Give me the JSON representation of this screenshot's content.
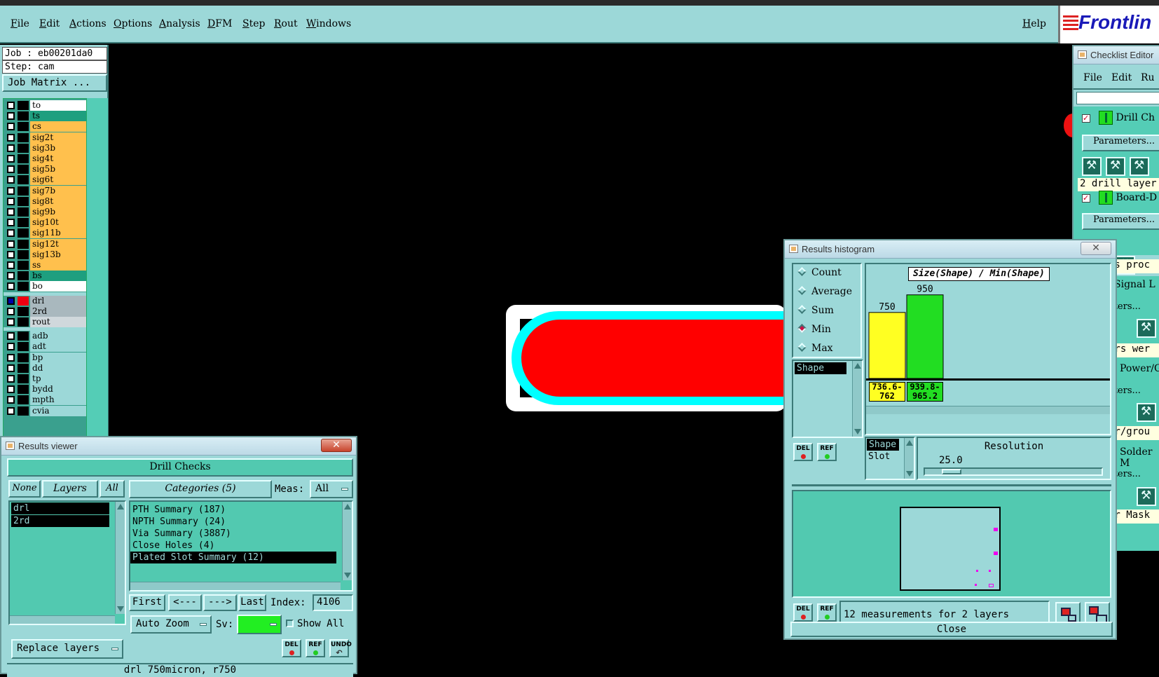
{
  "menubar": {
    "items": [
      "File",
      "Edit",
      "Actions",
      "Options",
      "Analysis",
      "DFM",
      "Step",
      "Rout",
      "Windows"
    ],
    "help": "Help",
    "logo": "Frontlin"
  },
  "leftpanel": {
    "job": "Job : eb00201da0",
    "step": "Step: cam",
    "job_matrix": "Job Matrix ...",
    "layers": [
      {
        "name": "to",
        "color": "#ffffff"
      },
      {
        "name": "ts",
        "color": "#1e9f7f"
      },
      {
        "name": "cs",
        "color": "#ffc04d"
      },
      {
        "name": "sig2t",
        "color": "#ffc04d"
      },
      {
        "name": "sig3b",
        "color": "#ffc04d"
      },
      {
        "name": "sig4t",
        "color": "#ffc04d"
      },
      {
        "name": "sig5b",
        "color": "#ffc04d"
      },
      {
        "name": "sig6t",
        "color": "#ffc04d"
      },
      {
        "name": "sig7b",
        "color": "#ffc04d"
      },
      {
        "name": "sig8t",
        "color": "#ffc04d"
      },
      {
        "name": "sig9b",
        "color": "#ffc04d"
      },
      {
        "name": "sig10t",
        "color": "#ffc04d"
      },
      {
        "name": "sig11b",
        "color": "#ffc04d"
      },
      {
        "name": "sig12t",
        "color": "#ffc04d"
      },
      {
        "name": "sig13b",
        "color": "#ffc04d"
      },
      {
        "name": "ss",
        "color": "#ffc04d"
      },
      {
        "name": "bs",
        "color": "#1e9f7f"
      },
      {
        "name": "bo",
        "color": "#ffffff"
      },
      {
        "name": "drl",
        "color": "#a9b8be"
      },
      {
        "name": "2rd",
        "color": "#a9b8be"
      },
      {
        "name": "rout",
        "color": "#d0d8dc"
      },
      {
        "name": "adb",
        "color": "#9cd8d8"
      },
      {
        "name": "adt",
        "color": "#9cd8d8"
      },
      {
        "name": "bp",
        "color": "#9cd8d8"
      },
      {
        "name": "dd",
        "color": "#9cd8d8"
      },
      {
        "name": "tp",
        "color": "#9cd8d8"
      },
      {
        "name": "bydd",
        "color": "#9cd8d8"
      },
      {
        "name": "mpth",
        "color": "#9cd8d8"
      },
      {
        "name": "cvia",
        "color": "#9cd8d8"
      }
    ]
  },
  "results_viewer": {
    "title": "Results viewer",
    "header": "Drill Checks",
    "none": "None",
    "layers": "Layers",
    "all": "All",
    "categories": "Categories (5)",
    "meas_label": "Meas:",
    "meas_value": "All",
    "layer_items": [
      "drl",
      "2rd"
    ],
    "category_items": [
      "PTH Summary (187)",
      "NPTH Summary (24)",
      "Via Summary (3887)",
      "Close Holes (4)",
      "Plated Slot Summary (12)"
    ],
    "first": "First",
    "prev": "<---",
    "next": "--->",
    "last": "Last",
    "index_label": "Index:",
    "index_value": "4106",
    "auto_zoom": "Auto Zoom",
    "sv_label": "Sv:",
    "show_all": "Show All",
    "replace_layers": "Replace layers",
    "status": "drl 750micron, r750",
    "del": "DEL",
    "ref": "REF",
    "undo": "UNDO"
  },
  "histogram": {
    "title": "Results histogram",
    "modes": [
      "Count",
      "Average",
      "Sum",
      "Min",
      "Max"
    ],
    "selected_mode": "Min",
    "shape_list": [
      "Shape"
    ],
    "chart_label": "Size(Shape) / Min(Shape)",
    "shape_slot": [
      "Shape",
      "Slot"
    ],
    "resolution_label": "Resolution",
    "resolution_value": "25.0",
    "summary": "12 measurements for 2 layers",
    "close": "Close",
    "del": "DEL",
    "ref": "REF"
  },
  "chart_data": {
    "type": "bar",
    "title": "Size(Shape) / Min(Shape)",
    "categories": [
      "736.6-762",
      "939.8-965.2"
    ],
    "values": [
      750,
      950
    ],
    "colors": [
      "#ffff22",
      "#22dd22"
    ],
    "ylim": [
      0,
      1000
    ]
  },
  "checklist": {
    "title": "Checklist Editor",
    "menu": [
      "File",
      "Edit",
      "Ru"
    ],
    "drill_check": "Drill Ch",
    "parameters": "Parameters...",
    "drill_layers": "2 drill layer",
    "board": "Board-D",
    "params2": "Parameters...",
    "frag1": "rs proc",
    "signal": "Signal L",
    "frag2": "eters...",
    "frag3": "ers wer",
    "power": "Power/G",
    "frag4": "eters...",
    "frag5": "er/grou",
    "solder": "Solder M",
    "frag6": "eters...",
    "frag7": "er Mask"
  }
}
